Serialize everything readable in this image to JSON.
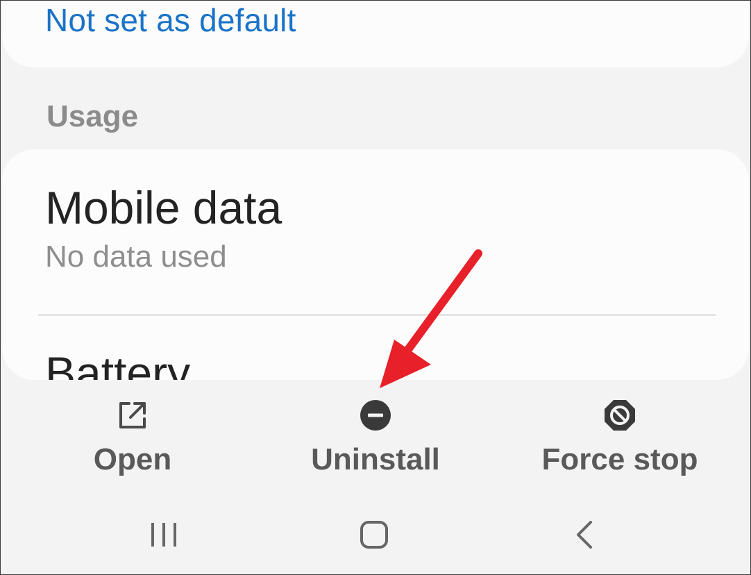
{
  "defaults": {
    "link_text": "Not set as default"
  },
  "usage": {
    "header": "Usage",
    "mobile_data": {
      "title": "Mobile data",
      "subtitle": "No data used"
    },
    "battery": {
      "title": "Battery"
    }
  },
  "actions": {
    "open_label": "Open",
    "uninstall_label": "Uninstall",
    "force_stop_label": "Force stop"
  },
  "icons": {
    "open": "open-external-icon",
    "uninstall": "minus-circle-icon",
    "force_stop": "blocked-circle-icon",
    "recents": "recents-icon",
    "home": "home-icon",
    "back": "back-icon"
  },
  "colors": {
    "link": "#1a73c9",
    "annotation": "#e8202a",
    "action_text": "#595959"
  }
}
